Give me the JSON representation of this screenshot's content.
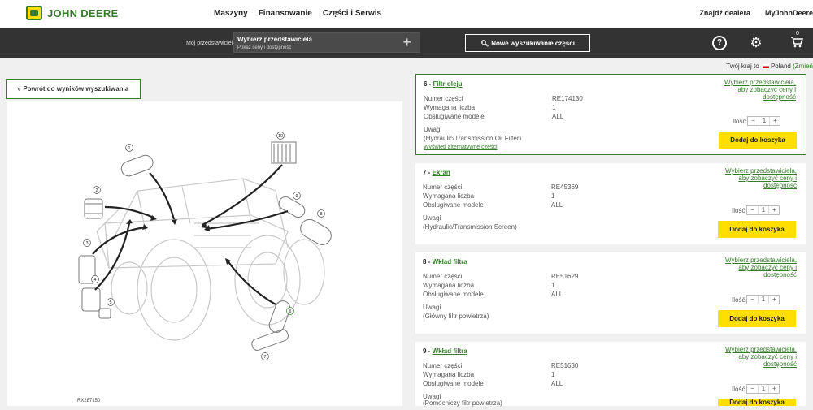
{
  "header": {
    "brand": "JOHN DEERE",
    "nav": [
      "Maszyny",
      "Finansowanie",
      "Części i Serwis"
    ],
    "right": [
      "Znajdź dealera",
      "MyJohnDeere"
    ]
  },
  "toolbar": {
    "rep_label": "Mój przedstawiciel",
    "rep_title": "Wybierz przedstawiciela",
    "rep_sub": "Pokaż ceny i dostępność",
    "new_search": "Nowe wyszukiwanie części",
    "cart_count": "0"
  },
  "country": {
    "prefix": "Twój kraj to",
    "name": "Poland",
    "change": "(Zmień"
  },
  "back_label": "Powrót do wyników wyszukiwania",
  "diagram": {
    "code": "RX287150",
    "callouts": [
      "1",
      "2",
      "3",
      "4",
      "5",
      "6",
      "7",
      "8",
      "9",
      "10"
    ]
  },
  "labels": {
    "part_no": "Numer części",
    "qty_req": "Wymagana liczba",
    "models": "Obsługiwane modele",
    "notes": "Uwagi",
    "qty": "Ilość",
    "add": "Dodaj do koszyka",
    "price": "Wybierz przedstawiciela, aby zobaczyć ceny i dostępność",
    "alt": "Wyświetl alternatywne części"
  },
  "parts": [
    {
      "num": "6",
      "name": "Filtr oleju",
      "part_no": "RE174130",
      "qty_req": "1",
      "models": "ALL",
      "note": "(Hydraulic/Transmission Oil Filter)",
      "qty": "1"
    },
    {
      "num": "7",
      "name": "Ekran",
      "part_no": "RE45369",
      "qty_req": "1",
      "models": "ALL",
      "note": "(Hydraulic/Transmission Screen)",
      "qty": "1"
    },
    {
      "num": "8",
      "name": "Wkład filtra",
      "part_no": "RE51629",
      "qty_req": "1",
      "models": "ALL",
      "note": "(Główny filtr powietrza)",
      "qty": "1"
    },
    {
      "num": "9",
      "name": "Wkład filtra",
      "part_no": "RE51630",
      "qty_req": "1",
      "models": "ALL",
      "note": "(Pomocniczy filtr powietrza)",
      "qty": "1"
    }
  ],
  "colors": {
    "brand_green": "#367c2b",
    "brand_yellow": "#ffde00",
    "bar": "#333333"
  }
}
